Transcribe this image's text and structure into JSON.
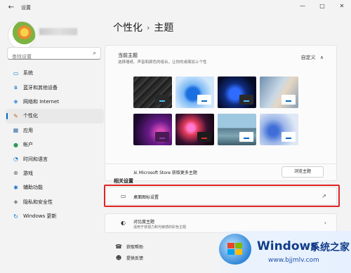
{
  "window": {
    "title": "设置",
    "back_glyph": "←",
    "minimize": "—",
    "maximize": "□",
    "close": "✕"
  },
  "sidebar": {
    "search_placeholder": "查找设置",
    "items": [
      {
        "label": "系统",
        "icon": "monitor-icon",
        "glyph": "▭",
        "color": "#0078d4"
      },
      {
        "label": "蓝牙和其他设备",
        "icon": "bluetooth-icon",
        "glyph": "ʙ",
        "color": "#0067c0"
      },
      {
        "label": "网络和 Internet",
        "icon": "wifi-icon",
        "glyph": "◆",
        "color": "#5aa0e0"
      },
      {
        "label": "个性化",
        "icon": "brush-icon",
        "glyph": "✎",
        "color": "#b6661e",
        "active": true
      },
      {
        "label": "应用",
        "icon": "apps-icon",
        "glyph": "▦",
        "color": "#3b6ea8"
      },
      {
        "label": "帐户",
        "icon": "account-icon",
        "glyph": "●",
        "color": "#2b9a5c"
      },
      {
        "label": "时间和语言",
        "icon": "clock-globe-icon",
        "glyph": "◔",
        "color": "#1b74c9"
      },
      {
        "label": "游戏",
        "icon": "gamepad-icon",
        "glyph": "⊕",
        "color": "#666666"
      },
      {
        "label": "辅助功能",
        "icon": "accessibility-icon",
        "glyph": "✱",
        "color": "#1b74c9"
      },
      {
        "label": "隐私和安全性",
        "icon": "shield-icon",
        "glyph": "◈",
        "color": "#6c6c6c"
      },
      {
        "label": "Windows 更新",
        "icon": "update-icon",
        "glyph": "↻",
        "color": "#0078d4"
      }
    ]
  },
  "main": {
    "breadcrumb": {
      "parent": "个性化",
      "separator": "›",
      "current": "主题"
    },
    "current_theme": {
      "title": "当前主题",
      "subtitle": "选择墙纸、声音和颜色的组合，让你的桌面加上个性",
      "value": "自定义",
      "chevron": "∧"
    },
    "themes": [
      {
        "name": "theme-dark-pattern"
      },
      {
        "name": "theme-windows-light"
      },
      {
        "name": "theme-windows-dark"
      },
      {
        "name": "theme-glow"
      },
      {
        "name": "theme-purple"
      },
      {
        "name": "theme-flower"
      },
      {
        "name": "theme-lake"
      },
      {
        "name": "theme-flow"
      }
    ],
    "store": {
      "text": "从 Microsoft Store 获取更多主题",
      "button": "浏览主题"
    },
    "related_title": "相关设置",
    "desktop_icons": {
      "label": "桌面图标设置",
      "end_glyph": "↗",
      "icon_glyph": "▭"
    },
    "contrast": {
      "label": "对比度主题",
      "sub": "适用于低视力和光敏感的彩色主题",
      "end_glyph": "›",
      "icon_glyph": "◐"
    },
    "help": [
      {
        "label": "获取帮助",
        "icon": "help-icon",
        "glyph": "☎"
      },
      {
        "label": "提供反馈",
        "icon": "feedback-icon",
        "glyph": "☻"
      }
    ]
  },
  "watermark": {
    "brand": "Windows",
    "brand_cn": "系统之家",
    "url": "www.bjjmlv.com"
  }
}
